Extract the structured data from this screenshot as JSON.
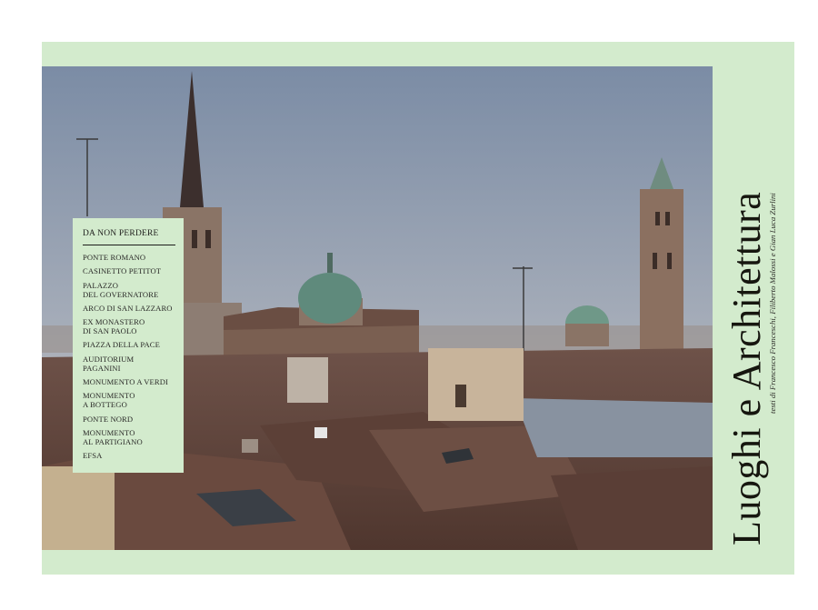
{
  "colors": {
    "frame": "#d3ebcd",
    "text": "#1d1d1b",
    "sky_top": "#7e8ea6",
    "sky_bottom": "#b9bcc3",
    "roof": "#6b4a3d"
  },
  "photo": {
    "alt_icon": "city-skyline-photo-icon"
  },
  "sidebar": {
    "title": "DA NON PERDERE",
    "items": [
      "PONTE ROMANO",
      "CASINETTO PETITOT",
      "PALAZZO\nDEL GOVERNATORE",
      "ARCO DI SAN LAZZARO",
      "EX MONASTERO\nDI SAN PAOLO",
      "PIAZZA DELLA PACE",
      "AUDITORIUM\nPAGANINI",
      "MONUMENTO A VERDI",
      "MONUMENTO\nA BOTTEGO",
      "PONTE NORD",
      "MONUMENTO\nAL PARTIGIANO",
      "EFSA"
    ]
  },
  "title": "Luoghi e Architettura",
  "credit": "testi di Francesco Franceschi, Filiberto Malossi e Gian Luca Zurlini"
}
